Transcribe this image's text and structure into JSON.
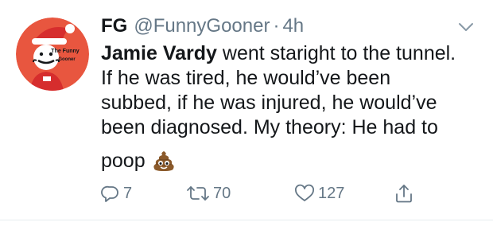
{
  "tweet": {
    "author": {
      "display_name": "FG",
      "handle": "@FunnyGooner",
      "avatar_text_line1": "The Funny",
      "avatar_text_line2": "Gooner",
      "avatar_colors": {
        "background": "#e8563f",
        "hat": "#d62d2d",
        "face": "#ffffff"
      }
    },
    "separator": "·",
    "timestamp": "4h",
    "text": {
      "line1_bold": "Jamie Vardy",
      "line1_rest": " went staright to the tunnel.",
      "line2": "If he was tired, he would’ve been",
      "line3": "subbed, if he was injured, he would’ve",
      "line4": "been diagnosed. My theory: He had to",
      "line5": "poop"
    },
    "emoji": "pile-of-poo",
    "actions": {
      "reply_count": "7",
      "retweet_count": "70",
      "like_count": "127"
    },
    "icons": {
      "reply": "reply-icon",
      "retweet": "retweet-icon",
      "like": "heart-icon",
      "share": "share-icon",
      "menu": "chevron-down-icon"
    },
    "colors": {
      "text": "#14171a",
      "secondary": "#657786",
      "divider": "#e6ecf0"
    }
  }
}
